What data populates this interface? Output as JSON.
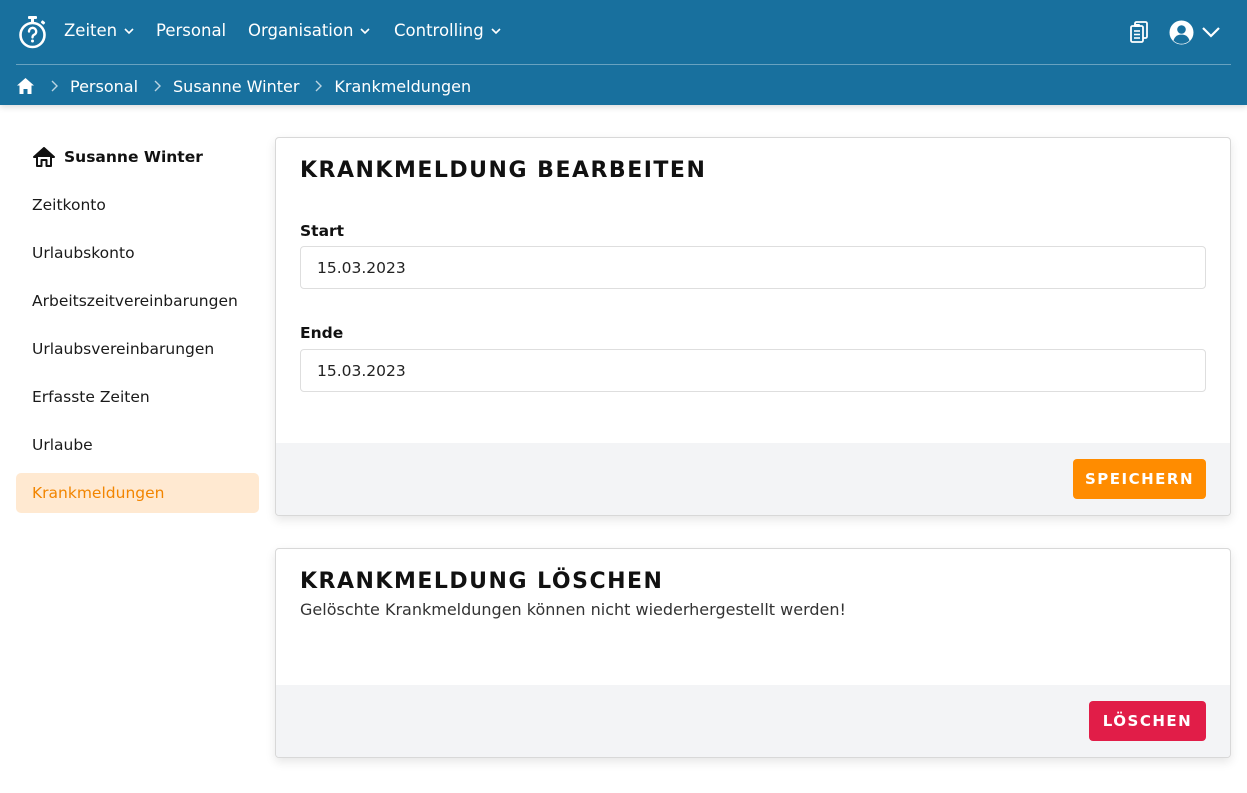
{
  "nav": {
    "items": [
      {
        "label": "Zeiten",
        "has_dropdown": true
      },
      {
        "label": "Personal",
        "has_dropdown": false
      },
      {
        "label": "Organisation",
        "has_dropdown": true
      },
      {
        "label": "Controlling",
        "has_dropdown": true
      }
    ],
    "icons": [
      "stopwatch-logo-icon",
      "clipboard-icon",
      "user-circle-icon",
      "chevron-down-icon"
    ]
  },
  "breadcrumb": {
    "items": [
      "Personal",
      "Susanne Winter",
      "Krankmeldungen"
    ]
  },
  "sidebar": {
    "title": "Susanne Winter",
    "items": [
      {
        "label": "Zeitkonto",
        "active": false
      },
      {
        "label": "Urlaubskonto",
        "active": false
      },
      {
        "label": "Arbeitszeitvereinbarungen",
        "active": false
      },
      {
        "label": "Urlaubsvereinbarungen",
        "active": false
      },
      {
        "label": "Erfasste Zeiten",
        "active": false
      },
      {
        "label": "Urlaube",
        "active": false
      },
      {
        "label": "Krankmeldungen",
        "active": true
      }
    ]
  },
  "edit_card": {
    "title": "KRANKMELDUNG BEARBEITEN",
    "start_label": "Start",
    "start_value": "15.03.2023",
    "end_label": "Ende",
    "end_value": "15.03.2023",
    "save_label": "SPEICHERN"
  },
  "delete_card": {
    "title": "KRANKMELDUNG LÖSCHEN",
    "note": "Gelöschte Krankmeldungen können nicht wiederhergestellt werden!",
    "delete_label": "LÖSCHEN"
  },
  "colors": {
    "header_bg": "#18709e",
    "accent_orange": "#ff8c00",
    "danger_red": "#e11d48",
    "active_bg": "#ffe9d1"
  }
}
